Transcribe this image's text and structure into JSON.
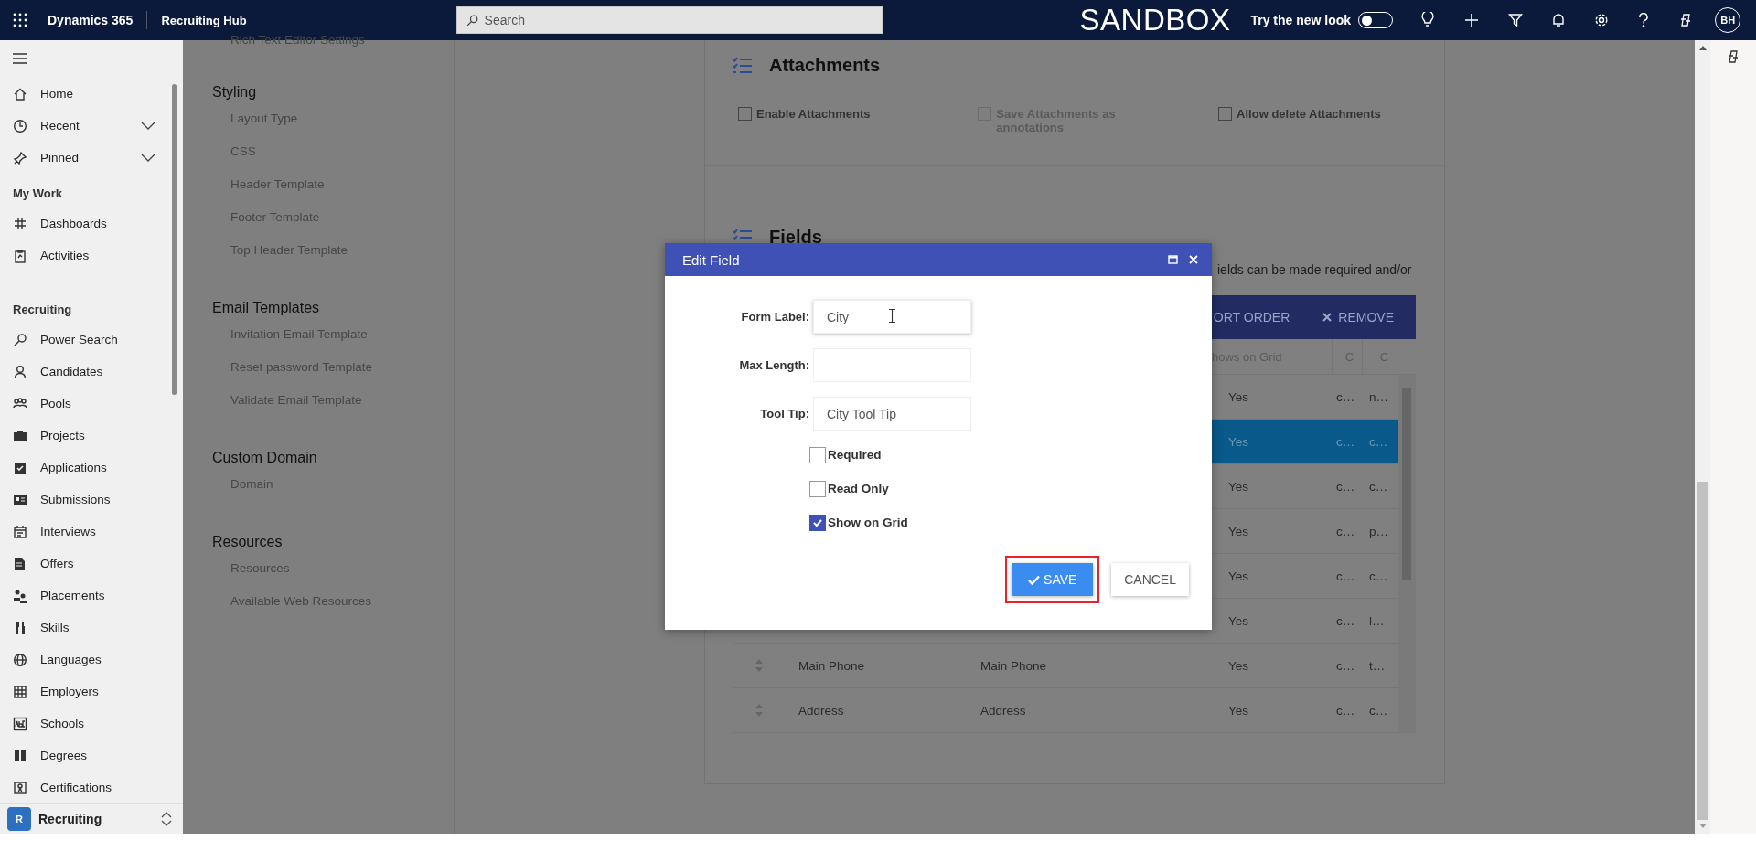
{
  "top_bar": {
    "app_name": "Dynamics 365",
    "area_name": "Recruiting Hub",
    "search": {
      "placeholder": "Search"
    },
    "environment": "SANDBOX",
    "new_look": {
      "label": "Try the new look",
      "on": false
    },
    "avatar": "BH"
  },
  "nav": {
    "sections": [
      {
        "items": [
          {
            "label": "Home"
          },
          {
            "label": "Recent",
            "expanded": false
          },
          {
            "label": "Pinned",
            "expanded": false
          }
        ]
      },
      {
        "heading": "My Work",
        "items": [
          {
            "label": "Dashboards"
          },
          {
            "label": "Activities"
          }
        ]
      },
      {
        "heading": "Recruiting",
        "items": [
          {
            "label": "Power Search"
          },
          {
            "label": "Candidates"
          },
          {
            "label": "Pools"
          },
          {
            "label": "Projects"
          },
          {
            "label": "Applications"
          },
          {
            "label": "Submissions"
          },
          {
            "label": "Interviews"
          },
          {
            "label": "Offers"
          },
          {
            "label": "Placements"
          },
          {
            "label": "Skills"
          },
          {
            "label": "Languages"
          },
          {
            "label": "Employers"
          },
          {
            "label": "Schools"
          },
          {
            "label": "Degrees"
          },
          {
            "label": "Certifications"
          }
        ]
      }
    ],
    "area": {
      "badge": "R",
      "label": "Recruiting"
    }
  },
  "settings": {
    "groups": [
      {
        "items": [
          "Rich Text Editor Settings"
        ]
      },
      {
        "heading": "Styling",
        "items": [
          "Layout Type",
          "CSS",
          "Header Template",
          "Footer Template",
          "Top Header Template"
        ]
      },
      {
        "heading": "Email Templates",
        "items": [
          "Invitation Email Template",
          "Reset password Template",
          "Validate Email Template"
        ]
      },
      {
        "heading": "Custom Domain",
        "items": [
          "Domain"
        ]
      },
      {
        "heading": "Resources",
        "items": [
          "Resources",
          "Available Web Resources"
        ]
      }
    ]
  },
  "attachments": {
    "title": "Attachments",
    "options": [
      {
        "label": "Enable Attachments",
        "checked": false,
        "disabled": false
      },
      {
        "label": "Save Attachments as annotations",
        "checked": false,
        "disabled": true
      },
      {
        "label": "Allow delete Attachments",
        "checked": false,
        "disabled": false
      }
    ]
  },
  "fields": {
    "title": "Fields",
    "description": "ields can be made required and/or",
    "toolbar": [
      {
        "label": "ORT ORDER",
        "kind": "text"
      },
      {
        "label": "REMOVE",
        "kind": "remove"
      }
    ],
    "columns": [
      "hows on Grid",
      "C",
      "C"
    ],
    "rows": [
      {
        "selected": false,
        "cells": [
          "Yes",
          "c…",
          "n…"
        ]
      },
      {
        "selected": true,
        "cells": [
          "Yes",
          "c…",
          "c…"
        ]
      },
      {
        "selected": false,
        "cells": [
          "Yes",
          "c…",
          "c…"
        ]
      },
      {
        "selected": false,
        "cells": [
          "Yes",
          "c…",
          "p…"
        ]
      },
      {
        "selected": false,
        "cells": [
          "Yes",
          "c…",
          "c…"
        ]
      },
      {
        "selected": false,
        "cells": [
          "Yes",
          "c…",
          "l…"
        ]
      },
      {
        "selected": false,
        "name": "Main Phone",
        "label": "Main Phone",
        "cells": [
          "Yes",
          "c…",
          "t…"
        ]
      },
      {
        "selected": false,
        "name": "Address",
        "label": "Address",
        "cells": [
          "Yes",
          "c…",
          "c…"
        ]
      }
    ]
  },
  "dialog": {
    "title": "Edit Field",
    "inputs": [
      {
        "label": "Form Label:",
        "value": "City"
      },
      {
        "label": "Max Length:"
      },
      {
        "label": "Tool Tip:",
        "value": "City Tool Tip"
      }
    ],
    "checks": [
      {
        "label": "Required",
        "checked": false
      },
      {
        "label": "Read Only",
        "checked": false
      },
      {
        "label": "Show on Grid",
        "checked": true
      }
    ],
    "buttons": [
      {
        "label": "SAVE",
        "kind": "primary",
        "highlighted": true
      },
      {
        "label": "CANCEL",
        "kind": "secondary",
        "highlighted": false
      }
    ]
  }
}
